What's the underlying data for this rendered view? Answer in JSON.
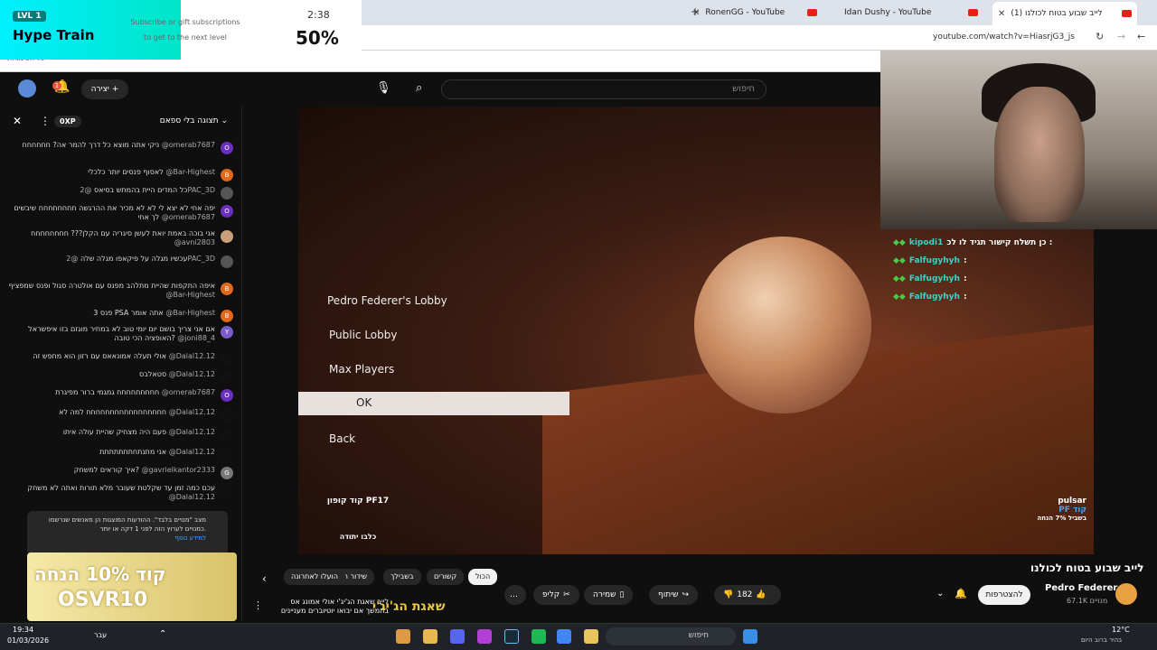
{
  "hype": {
    "level": "LVL 1",
    "title": "Hype Train",
    "subtitle": "Subscribe or gift subscriptions to get to the next level",
    "time": "2:38",
    "percent": "50%",
    "progress": 0.5
  },
  "browser": {
    "tabs": [
      {
        "label": "RonenGG - YouTube"
      },
      {
        "label": "Idan Dushy - YouTube"
      },
      {
        "label": "(1) לייב שבוע בטוח לכולנו"
      }
    ],
    "url": "youtube.com/watch?v=HiasrjG3_js",
    "bookmarks": "כל הסימניות"
  },
  "yt_top": {
    "search_placeholder": "חיפוש",
    "create_label": "יצירה",
    "notif_count": "1"
  },
  "chat": {
    "header": "תצוגה בלי ספאם",
    "xp": "0XP",
    "messages": [
      {
        "user": "@omerab7687",
        "text": "ניקי אתה מוצא כל דרך להמר אה? חחחחחח",
        "color": "#6b2fbf",
        "initial": "O"
      },
      {
        "user": "@Bar-Highest",
        "text": "לאסוף פנסים יותר כלכלי",
        "color": "#e06a1a",
        "initial": "B"
      },
      {
        "user": "@2PAC_3D",
        "text": "כל המדים היית בהמתש בסיאס",
        "color": "#555",
        "initial": "",
        "badge": "#2"
      },
      {
        "user": "@omerab7687",
        "text": "יפה אחי לא יצא לי לא לא מכיר את ההרגשה חחחחחחחח שיבשים לך אחי",
        "color": "#6b2fbf",
        "initial": "O"
      },
      {
        "user": "@avni2803",
        "text": "אני בוכה באמת יואת לעשן סיגריה עם הקלן??? חחחחחחחח",
        "color": "#c9a07a",
        "initial": ""
      },
      {
        "user": "@2PAC_3D",
        "text": "עכשיו מגלה על פיקאפו מגלה שלה",
        "color": "#555",
        "initial": "",
        "badge": "#2"
      },
      {
        "user": "@Bar-Highest",
        "text": "איפה התקפות שהיית מתלהב מפנס עם אולטרה סגול ופנס שמפציף",
        "color": "#e06a1a",
        "initial": "B"
      },
      {
        "user": "@Bar-Highest",
        "text": "פנס 3 PSA אתה אומר",
        "color": "#e06a1a",
        "initial": "B"
      },
      {
        "user": "@joni88_4",
        "text": "אם אני צריך בושם יום יומי טוב לא במחיר מוגזם בזו איפשראל האופציה הכי טובה?",
        "color": "#7a5cc8",
        "initial": "Y"
      },
      {
        "user": "@Dalal12.12",
        "text": "אולי תעלה אמונאאס עם רזון הוא מחפש זה",
        "color": "#111",
        "initial": ""
      },
      {
        "user": "@Dalal12.12",
        "text": "סטאלבס",
        "color": "#111",
        "initial": ""
      },
      {
        "user": "@omerab7687",
        "text": "חחחחחחחחח גמגמי ברור מפיגרת",
        "color": "#6b2fbf",
        "initial": "O"
      },
      {
        "user": "@Dalal12.12",
        "text": "חחחחחחחחחחחחחחחחח למה לא",
        "color": "#111",
        "initial": ""
      },
      {
        "user": "@Dalal12.12",
        "text": "פעם היה מצחיק שהיית עולה איתו",
        "color": "#111",
        "initial": ""
      },
      {
        "user": "@Dalal12.12",
        "text": "אני מתנתחתתתתתתת",
        "color": "#111",
        "initial": ""
      },
      {
        "user": "@gavrielkantor2333",
        "text": "איך קוראים למשחק?",
        "color": "#777",
        "initial": "G",
        "badge": "#1"
      },
      {
        "user": "@Dalal12.12",
        "text": "עכם כמה זמן עד שקלטת שעובר מלא תורות ואתה לא משחק",
        "color": "#111",
        "initial": ""
      }
    ],
    "notice": "מצב \"מנויים בלבד\". ההודעות המוצגות הן מאנשים שנרשמו כמנויים לערוץ הזה לפני 1 דקה או יותר.",
    "notice_more": "למידע נוסף",
    "promo_line1": "קוד 10% הנחה",
    "promo_line2": "OSVR10"
  },
  "game": {
    "menu": [
      "Pedro Federer's Lobby",
      "Public Lobby",
      "Max Players",
      "OK",
      "Back"
    ],
    "promo_code": "קוד קופון PF17",
    "promo_sub": "כלבו יתודה",
    "sponsor": "pulsar",
    "sponsor_code": "PF קוד",
    "sponsor_sub": "בשביל 7% הנחה"
  },
  "stream_chat": [
    {
      "user": "kipodi1",
      "text": "כן תשלח קישור תגיד לו לכ :"
    },
    {
      "user": "Falfugyhyh",
      "text": ":"
    },
    {
      "user": "Falfugyhyh",
      "text": ":"
    },
    {
      "user": "Falfugyhyh",
      "text": ":"
    }
  ],
  "video_info": {
    "title": "לייב שבוע בטוח לכולנו",
    "channel": "Pedro Federer",
    "subs": "67.1K מנויים",
    "subscribe": "להצטרפות",
    "likes": "182",
    "share": "שיתוף",
    "save": "שמירה",
    "clip": "קליפ",
    "chips": [
      "הכול",
      "קשורים",
      "בשבילך",
      "שידור חי",
      "הועלו לאחרונה"
    ],
    "rec_title": "שאגת הג'יג'י",
    "rec_text": "לייב שאגת הג'יג'י אולי אמונג אס בהמשך אם יבואו יוטיוברים מעניינים"
  },
  "taskbar": {
    "time": "19:34",
    "date": "01/03/2026",
    "lang": "עבר",
    "search": "חיפוש",
    "weather": "12°C",
    "weather_sub": "בהיר ברוב היום"
  }
}
